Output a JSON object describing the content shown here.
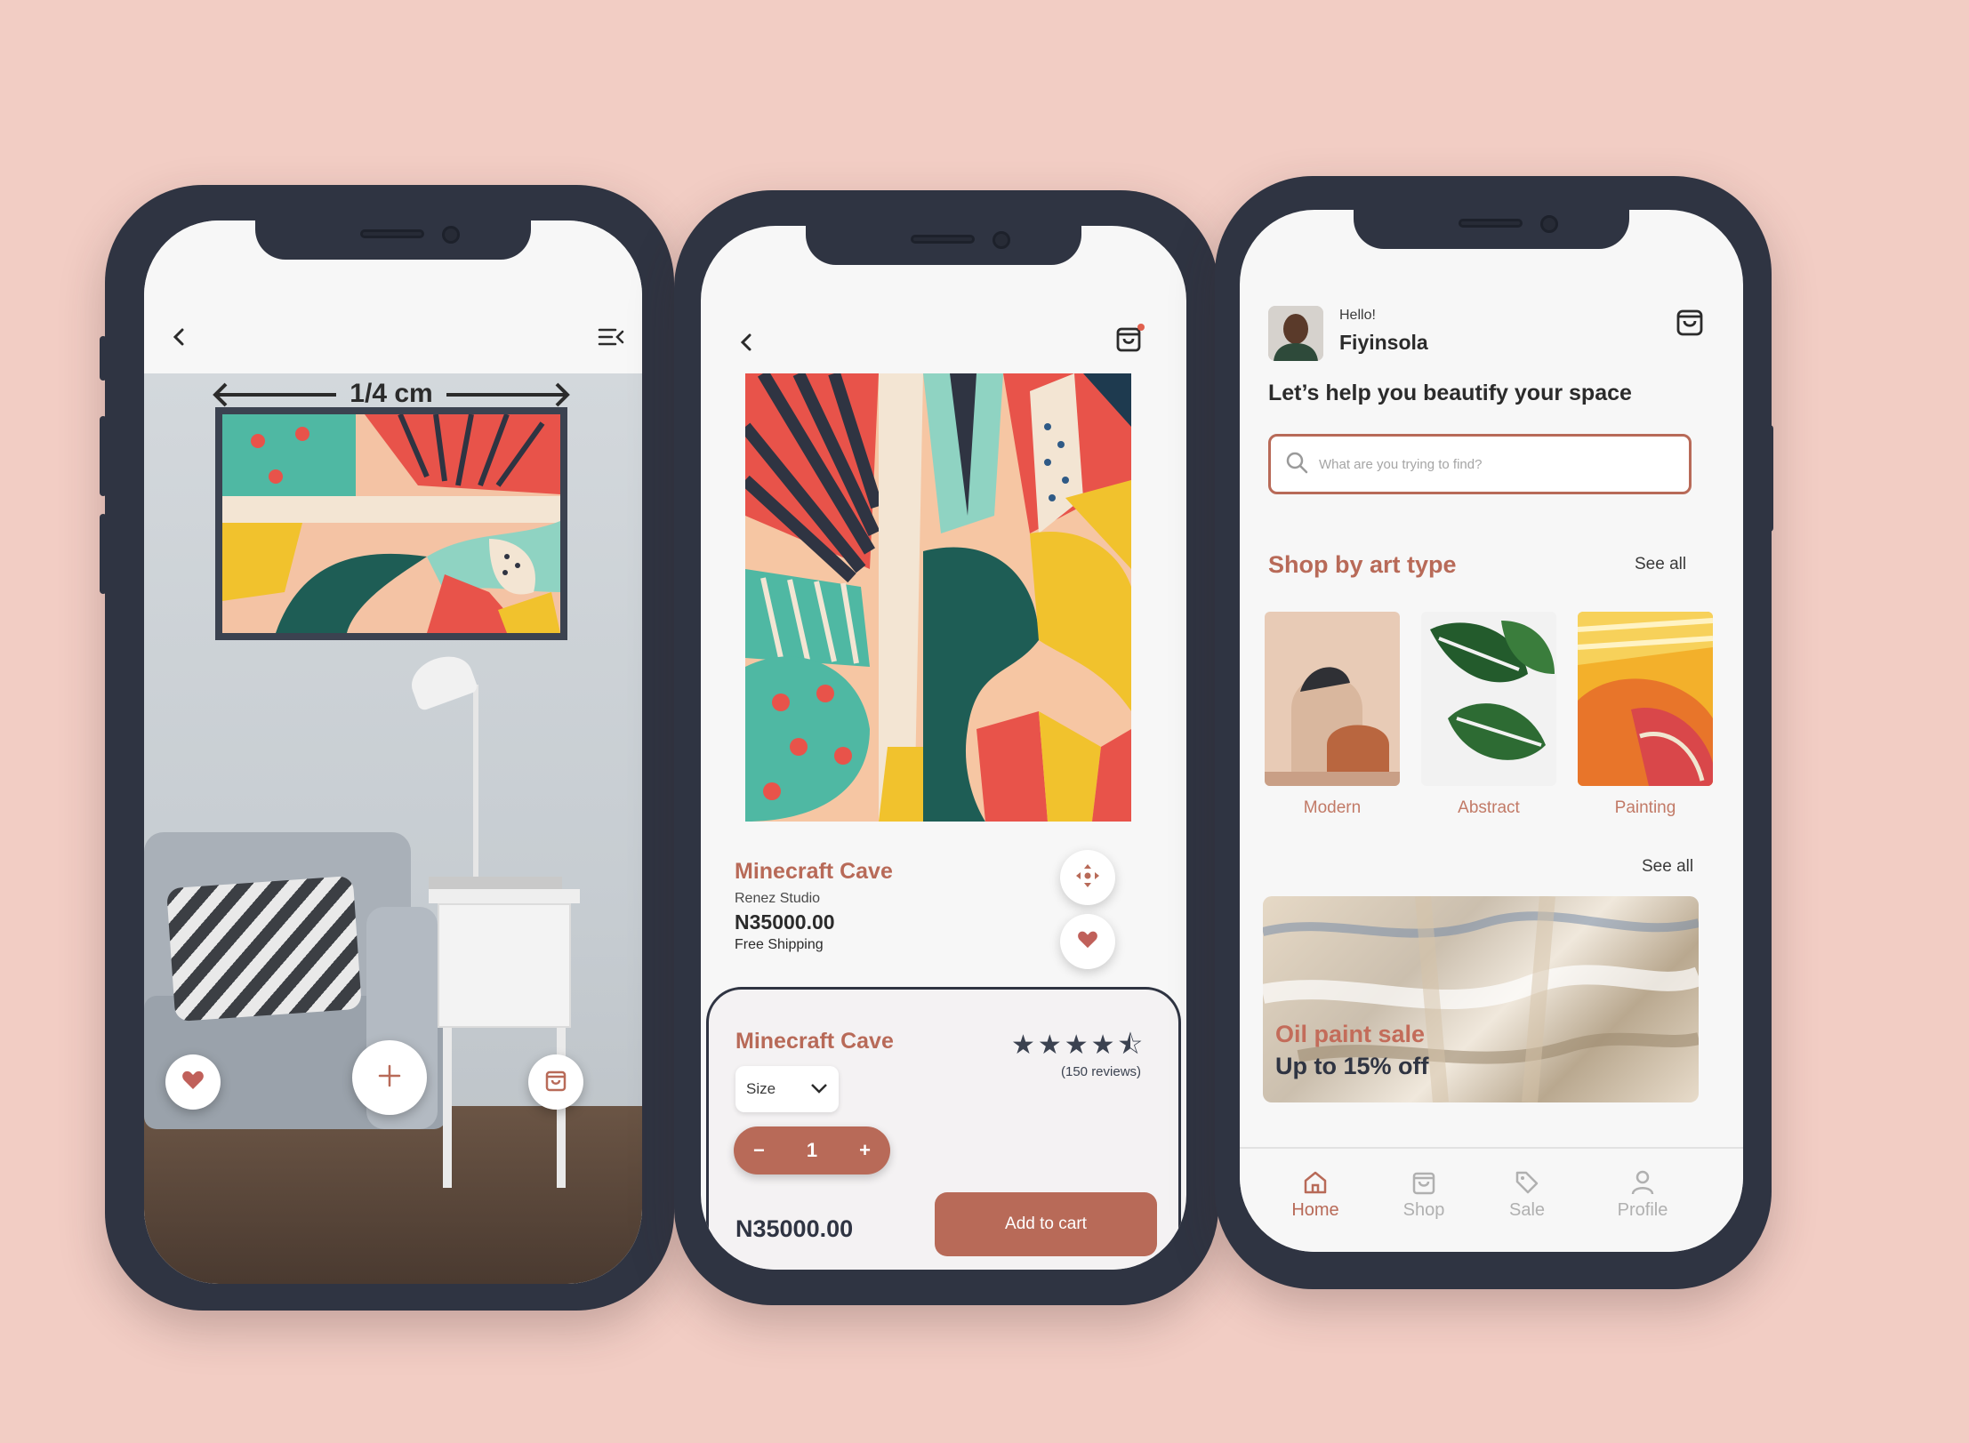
{
  "colors": {
    "background": "#f2cdc4",
    "accent": "#b86a58",
    "frame": "#2f3442",
    "screen": "#f7f7f7"
  },
  "ar_screen": {
    "back_icon": "chevron-left-icon",
    "menu_icon": "menu-collapse-icon",
    "measurement": "1/4 cm",
    "actions": [
      {
        "name": "favorite",
        "icon": "heart-icon"
      },
      {
        "name": "add",
        "icon": "plus-icon"
      },
      {
        "name": "cart",
        "icon": "bag-icon"
      }
    ]
  },
  "product_screen": {
    "back_icon": "chevron-left-icon",
    "cart_icon": "bag-icon",
    "title": "Minecraft Cave",
    "artist": "Renez Studio",
    "price": "N35000.00",
    "shipping": "Free Shipping",
    "sheet": {
      "title": "Minecraft Cave",
      "rating": 4.5,
      "stars": "★★★★⯪",
      "reviews": "(150 reviews)",
      "size_label": "Size",
      "quantity": "1",
      "minus": "−",
      "plus": "+",
      "price": "N35000.00",
      "add_to_cart": "Add to cart"
    }
  },
  "home_screen": {
    "greeting": "Hello!",
    "user_name": "Fiyinsola",
    "tagline": "Let’s help you beautify your space",
    "search_placeholder": "What are you trying to find?",
    "section_title": "Shop by art type",
    "see_all_1": "See all",
    "see_all_2": "See all",
    "categories": [
      {
        "label": "Modern"
      },
      {
        "label": "Abstract"
      },
      {
        "label": "Painting"
      }
    ],
    "banner": {
      "title": "Oil paint sale",
      "subtitle": "Up to 15% off"
    },
    "tabs": [
      {
        "label": "Home",
        "icon": "home-icon",
        "active": true
      },
      {
        "label": "Shop",
        "icon": "bag-icon",
        "active": false
      },
      {
        "label": "Sale",
        "icon": "tag-icon",
        "active": false
      },
      {
        "label": "Profile",
        "icon": "user-icon",
        "active": false
      }
    ]
  }
}
